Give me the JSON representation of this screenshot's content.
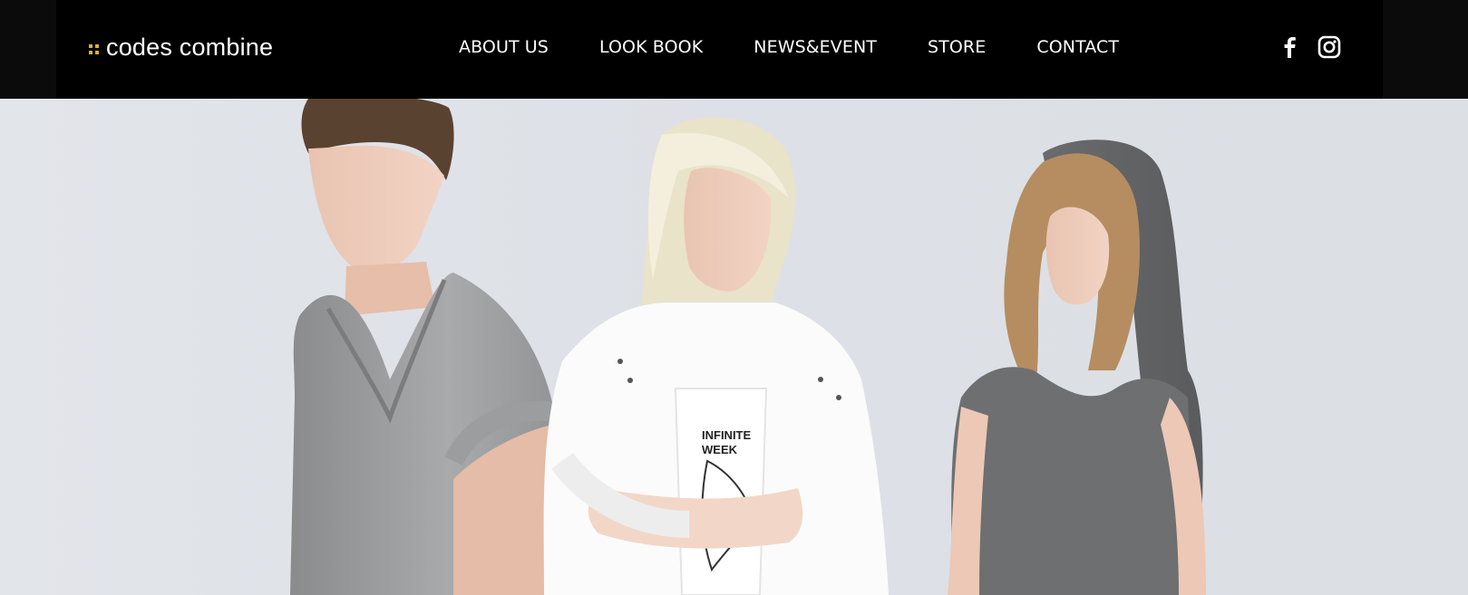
{
  "brand": {
    "name": "codes combine",
    "mark_color": "#d8b23a"
  },
  "nav": {
    "items": [
      "ABOUT US",
      "LOOK BOOK",
      "NEWS&EVENT",
      "STORE",
      "CONTACT"
    ]
  },
  "social": {
    "icons": [
      "facebook-icon",
      "instagram-icon"
    ]
  },
  "hero": {
    "models": [
      "male-model",
      "blonde-model",
      "hooded-model"
    ],
    "tshirt_text": [
      "INFINITE",
      "WEEK"
    ]
  },
  "colors": {
    "header_bg": "#000000",
    "hero_bg": "#dfe2e7",
    "text": "#ffffff"
  }
}
